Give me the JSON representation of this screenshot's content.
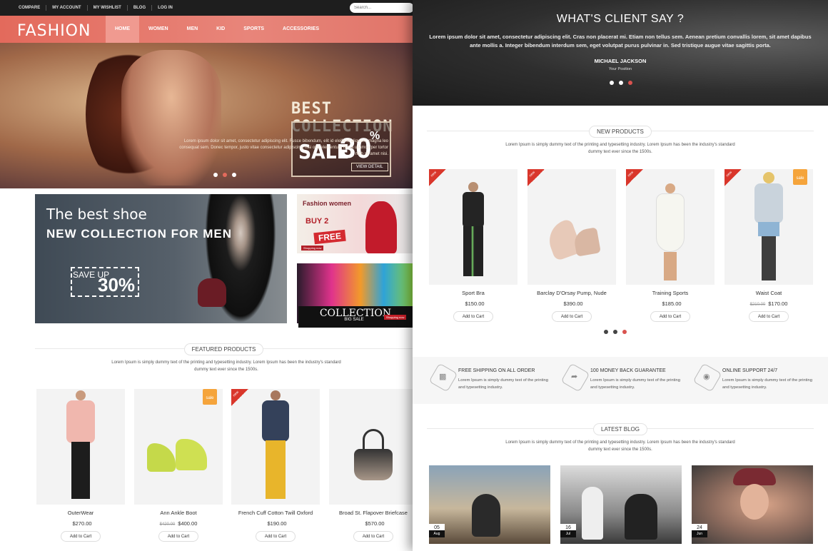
{
  "topbar": {
    "links": [
      "COMPARE",
      "MY ACCOUNT",
      "MY WISHLIST",
      "BLOG",
      "LOG IN"
    ],
    "search_placeholder": "Search..."
  },
  "nav": {
    "logo": "FASHION",
    "items": [
      "HOME",
      "WOMEN",
      "MEN",
      "KID",
      "SPORTS",
      "ACCESSORIES"
    ],
    "active": "HOME"
  },
  "hero": {
    "headline": "BEST COLLECTION",
    "sale_word": "SALE",
    "sale_value": "30",
    "sale_unit": "%",
    "text": "Lorem ipsum dolor sit amet, consectetur adipiscing elit. Fusce bibendum, elit id eleifend aliquam, magna leo consequat sem. Donec tempor, justo vitae consectetur adipiscing, nisi orci elementum dui, a ullamcorper tortor nibh sit amet nisi.",
    "button": "VIEW DETAIL"
  },
  "banner_men": {
    "line1": "The best shoe",
    "line2": "NEW COLLECTION FOR MEN",
    "save": "SAVE UP",
    "percent": "30%"
  },
  "banner_women": {
    "title": "Fashion women",
    "buy": "BUY 2",
    "free": "FREE",
    "shop": "Shopping now"
  },
  "banner_collection": {
    "title": "COLLECTION",
    "sub": "BIG SALE",
    "shop": "Shopping now"
  },
  "featured": {
    "heading": "FEATURED PRODUCTS",
    "desc": "Lorem Ipsum is simply dummy text of the printing and typesetting industry. Lorem Ipsum has been the industry's standard dummy text ever since the 1500s.",
    "items": [
      {
        "name": "OuterWear",
        "old": "",
        "price": "$270.00",
        "cta": "Add to Cart"
      },
      {
        "name": "Ann Ankle Boot",
        "old": "$420.00",
        "price": "$400.00",
        "cta": "Add to Cart",
        "badge": "sale"
      },
      {
        "name": "French Cuff Cotton Twill Oxford",
        "old": "",
        "price": "$190.00",
        "cta": "Add to Cart",
        "ribbon": "new"
      },
      {
        "name": "Broad St. Flapover Briefcase",
        "old": "",
        "price": "$570.00",
        "cta": "Add to Cart"
      }
    ]
  },
  "testimonial": {
    "title": "WHAT'S CLIENT SAY ?",
    "text": "Lorem ipsum dolor sit amet, consectetur adipiscing elit. Cras non placerat mi. Etiam non tellus sem. Aenean pretium convallis lorem, sit amet dapibus ante mollis a. Integer bibendum interdum sem, eget volutpat purus pulvinar in. Sed tristique augue vitae sagittis porta.",
    "name": "MICHAEL JACKSON",
    "position": "Your Position"
  },
  "new_products": {
    "heading": "NEW PRODUCTS",
    "desc": "Lorem Ipsum is simply dummy text of the printing and typesetting industry. Lorem Ipsum has been the industry's standard dummy text ever since the 1500s.",
    "items": [
      {
        "name": "Sport Bra",
        "old": "",
        "price": "$150.00",
        "cta": "Add to Cart",
        "ribbon": "new"
      },
      {
        "name": "Barclay D'Orsay Pump, Nude",
        "old": "",
        "price": "$390.00",
        "cta": "Add to Cart",
        "ribbon": "new"
      },
      {
        "name": "Training Sports",
        "old": "",
        "price": "$185.00",
        "cta": "Add to Cart",
        "ribbon": "new"
      },
      {
        "name": "Waist Coat",
        "old": "$210.00",
        "price": "$170.00",
        "cta": "Add to Cart",
        "ribbon": "new",
        "badge": "sale"
      }
    ]
  },
  "features": [
    {
      "title": "FREE SHIPPING ON ALL ORDER",
      "desc": "Lorem Ipsum is simply dummy text of the printing and typesetting industry.",
      "icon": "truck-icon"
    },
    {
      "title": "100 MONEY BACK GUARANTEE",
      "desc": "Lorem Ipsum is simply dummy text of the printing and typesetting industry.",
      "icon": "share-arrow-icon"
    },
    {
      "title": "ONLINE SUPPORT 24/7",
      "desc": "Lorem Ipsum is simply dummy text of the printing and typesetting industry.",
      "icon": "chat-icon"
    }
  ],
  "blog": {
    "heading": "LATEST BLOG",
    "desc": "Lorem Ipsum is simply dummy text of the printing and typesetting industry. Lorem Ipsum has been the industry's standard dummy text ever since the 1500s.",
    "posts": [
      {
        "day": "05",
        "month": "Aug"
      },
      {
        "day": "16",
        "month": "Jul"
      },
      {
        "day": "24",
        "month": "Jun"
      }
    ]
  },
  "colors": {
    "accent": "#e36a5c",
    "dot_active": "#d9534f"
  }
}
